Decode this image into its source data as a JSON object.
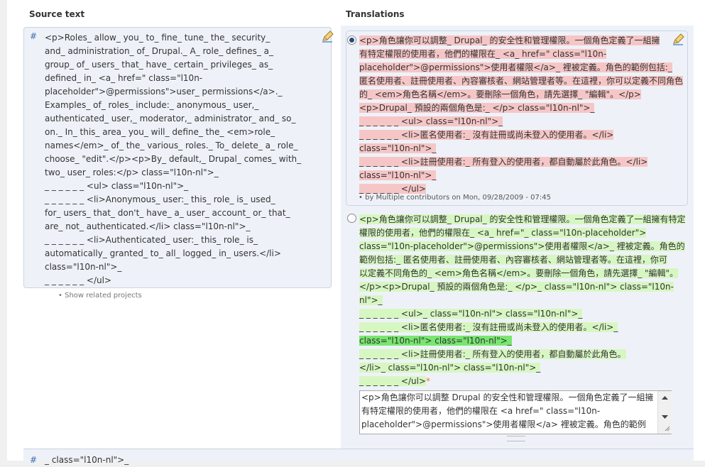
{
  "headers": {
    "source": "Source text",
    "translations": "Translations"
  },
  "source": {
    "hash": "#",
    "lines": [
      "<p>Roles_ allow_ you_ to_ fine_ tune_ the_ security_",
      "and_ administration_ of_ Drupal._ A_ role_ defines_ a_",
      "group_ of_ users_ that_ have_ certain_ privileges_ as_",
      "defined_ in_ <a_ href=\" class=\"l10n-",
      "placeholder\">@permissions\">user_ permissions</a>._",
      "Examples_ of_ roles_ include:_ anonymous_ user,_",
      "authenticated_ user,_ moderator,_ administrator_ and_ so_",
      "on._ In_ this_ area_ you_ will_ define_ the_ <em>role_",
      "names</em>_ of_ the_ various_ roles._ To_ delete_ a_ role_",
      "choose_ \"edit\".</p><p>By_ default,_ Drupal_ comes_ with_",
      "two_ user_ roles:</p> class=\"l10n-nl\">_",
      "_ _ _ _ _ _ <ul> class=\"l10n-nl\">_",
      "_ _ _ _ _ _ <li>Anonymous_ user:_ this_ role_ is_ used_",
      "for_ users_ that_ don't_ have_ a_ user_ account_ or_ that_",
      "are_ not_ authenticated.</li> class=\"l10n-nl\">_",
      "_ _ _ _ _ _ <li>Authenticated_ user:_ this_ role_ is_",
      "automatically_ granted_ to_ all_ logged_ in_ users.</li>",
      "class=\"l10n-nl\">_",
      "_ _ _ _ _ _ </ul>"
    ],
    "related": "Show related projects"
  },
  "translation1": {
    "lines": [
      "<p>角色讓你可以調整_ Drupal_ 的安全性和管理權限。一個角色定義了一組擁",
      "有特定權限的使用者，他們的權限在_ <a_ href=\" class=\"l10n-",
      "placeholder\">@permissions\">使用者權限</a>_ 裡被定義。角色的範例包括:_",
      "匿名使用者、註冊使用者、內容審核者、網站管理者等。在這裡，你可以定義不同角色",
      "的_ <em>角色名稱</em>。要刪除一個角色，請先選擇_ \"編輯\"。</p>",
      "<p>Drupal_ 預設的兩個角色是:_ </p> class=\"l10n-nl\">_",
      "_ _ _ _ _ _ <ul> class=\"l10n-nl\">_",
      "_ _ _ _ _ _ <li>匿名使用者:_ 沒有註冊或尚未登入的使用者。</li>",
      "class=\"l10n-nl\">_",
      "_ _ _ _ _ _ <li>註冊使用者:_ 所有登入的使用者，都自動屬於此角色。</li>",
      "class=\"l10n-nl\">_",
      "_ _ _ _ _ _ </ul>"
    ],
    "meta": "by Multiple contributors on Mon, 09/28/2009 - 07:45"
  },
  "translation2": {
    "lines": [
      "<p>角色讓你可以調整_ Drupal_ 的安全性和管理權限。一個角色定義了一組擁有特定",
      "權限的使用者，他們的權限在_ <a_ href=\"_ class=\"l10n-placeholder\">",
      "class=\"l10n-placeholder\">@permissions\">使用者權限</a>_ 裡被定義。角色的",
      "範例包括:_ 匿名使用者、註冊使用者、內容審核者、網站管理者等。在這裡，你可",
      "以定義不同角色的_ <em>角色名稱</em>。要刪除一個角色，請先選擇_ \"編輯\"。",
      "</p><p>Drupal_ 預設的兩個角色是:_ </p>_ class=\"l10n-nl\"> class=\"l10n-",
      "nl\">_",
      "_ _ _ _ _ _ <ul>_ class=\"l10n-nl\"> class=\"l10n-nl\">_",
      "_ _ _ _ _ _ <li>匿名使用者:_ 沒有註冊或尚未登入的使用者。</li>_",
      "class=\"l10n-nl\"> class=\"l10n-nl\">_",
      "_ _ _ _ _ _ <li>註冊使用者:_ 所有登入的使用者，都自動屬於此角色。",
      "</li>_ class=\"l10n-nl\"> class=\"l10n-nl\">_",
      "_ _ _ _ _ _ </ul>",
      "*"
    ]
  },
  "editor": {
    "lines": [
      "<p>角色讓你可以調整 Drupal 的安全性和管理權限。一個角色定義了一組擁",
      "有特定權限的使用者，他們的權限在 <a href=\" class=\"l10n-",
      "placeholder\">@permissions\">使用者權限</a> 裡被定義。角色的範例"
    ]
  },
  "bottom": {
    "hash": "#",
    "text": "_ class=\"l10n-nl\">_"
  }
}
